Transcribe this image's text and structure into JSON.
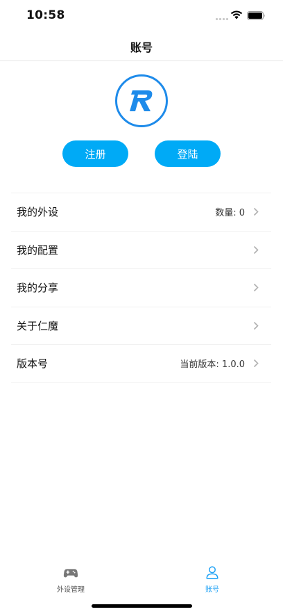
{
  "status_bar": {
    "time": "10:58"
  },
  "nav": {
    "title": "账号"
  },
  "auth": {
    "register_label": "注册",
    "login_label": "登陆"
  },
  "menu": [
    {
      "label": "我的外设",
      "value": "数量: 0"
    },
    {
      "label": "我的配置",
      "value": ""
    },
    {
      "label": "我的分享",
      "value": ""
    },
    {
      "label": "关于仁魔",
      "value": ""
    },
    {
      "label": "版本号",
      "value": "当前版本: 1.0.0"
    }
  ],
  "tab_bar": {
    "tabs": [
      {
        "label": "外设管理",
        "icon": "gamepad-icon",
        "active": false
      },
      {
        "label": "账号",
        "icon": "person-icon",
        "active": true
      }
    ]
  },
  "colors": {
    "accent": "#00aaf6",
    "logo_blue": "#1e8bea",
    "active_tab": "#1aa0f5"
  }
}
